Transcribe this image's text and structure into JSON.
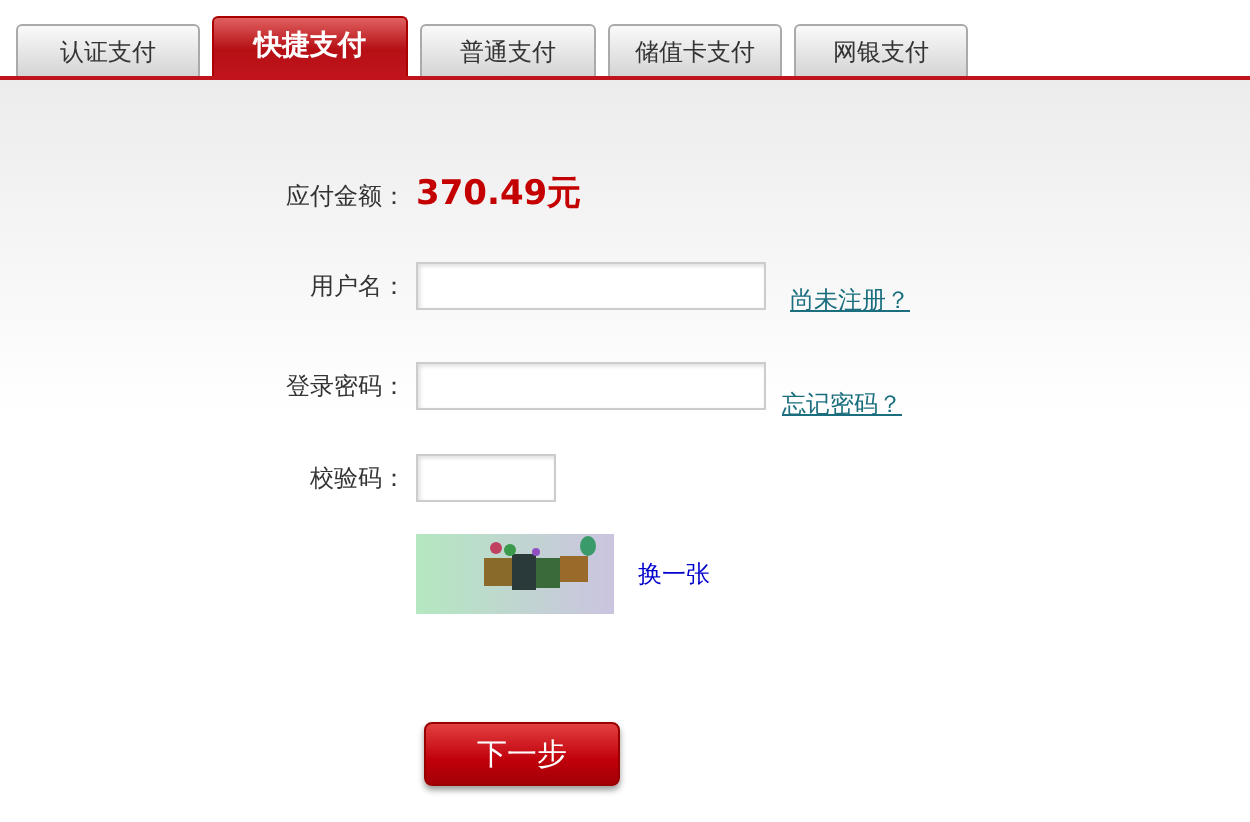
{
  "tabs": [
    {
      "label": "认证支付",
      "selected": false
    },
    {
      "label": "快捷支付",
      "selected": true
    },
    {
      "label": "普通支付",
      "selected": false
    },
    {
      "label": "储值卡支付",
      "selected": false
    },
    {
      "label": "网银支付",
      "selected": false
    }
  ],
  "amount": {
    "label": "应付金额：",
    "value": "370.49元"
  },
  "fields": [
    {
      "label": "用户名：",
      "link": "尚未注册？",
      "kind": "wide"
    },
    {
      "label": "登录密码：",
      "link": "忘记密码？",
      "kind": "wide"
    },
    {
      "label": "校验码：",
      "kind": "short"
    }
  ],
  "captcha": {
    "kind": "picture",
    "refresh": "换一张"
  },
  "submit": "下一步"
}
